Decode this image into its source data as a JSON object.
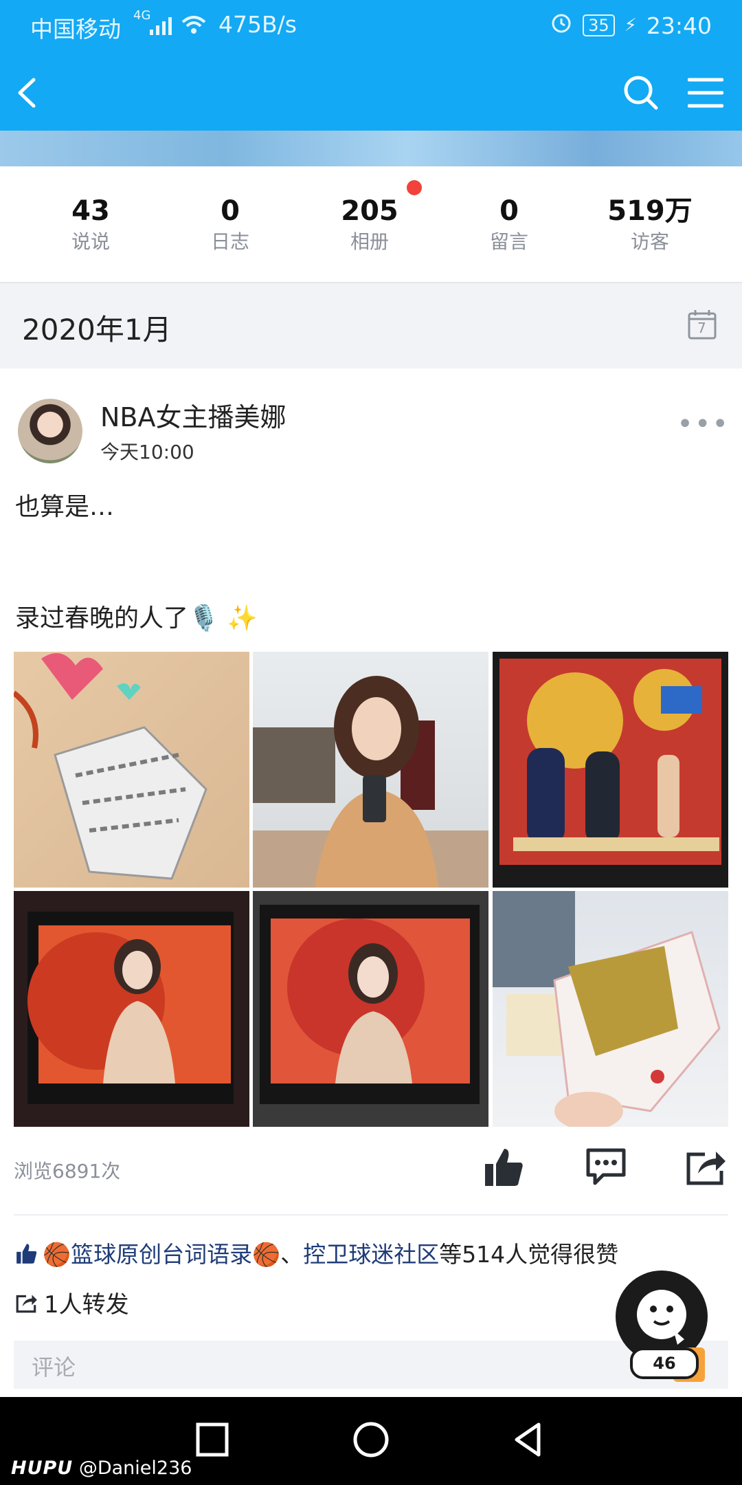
{
  "status_bar": {
    "carrier": "中国移动",
    "network": "4G",
    "speed": "475B/s",
    "battery": "35",
    "time": "23:40"
  },
  "header": {
    "icons": [
      "back-arrow-icon",
      "search-icon",
      "menu-icon"
    ]
  },
  "stats": [
    {
      "value": "43",
      "label": "说说"
    },
    {
      "value": "0",
      "label": "日志"
    },
    {
      "value": "205",
      "label": "相册"
    },
    {
      "value": "0",
      "label": "留言"
    },
    {
      "value": "519万",
      "label": "访客"
    }
  ],
  "month_bar": {
    "label": "2020年1月",
    "calendar_icon_text": "7"
  },
  "post": {
    "author": "NBA女主播美娜",
    "time": "今天10:00",
    "text_line1": "也算是…",
    "text_line2": "录过春晚的人了🎙️ ✨",
    "photos": [
      "photo-1",
      "photo-2",
      "photo-3",
      "photo-4",
      "photo-5",
      "photo-6"
    ],
    "views": "浏览6891次",
    "likes": {
      "name1": "🏀篮球原创台词语录🏀",
      "separator": "、",
      "name2": "控卫球迷社区",
      "suffix": "等514人觉得很赞"
    },
    "forwards": "1人转发",
    "comment_placeholder": "评论"
  },
  "floating_button": {
    "count": "46"
  },
  "watermark": {
    "brand": "HUPU",
    "handle": "@Daniel236"
  },
  "colors": {
    "header_blue": "#13a9f4",
    "link_blue": "#1f3c78",
    "red_dot": "#f1423b"
  }
}
